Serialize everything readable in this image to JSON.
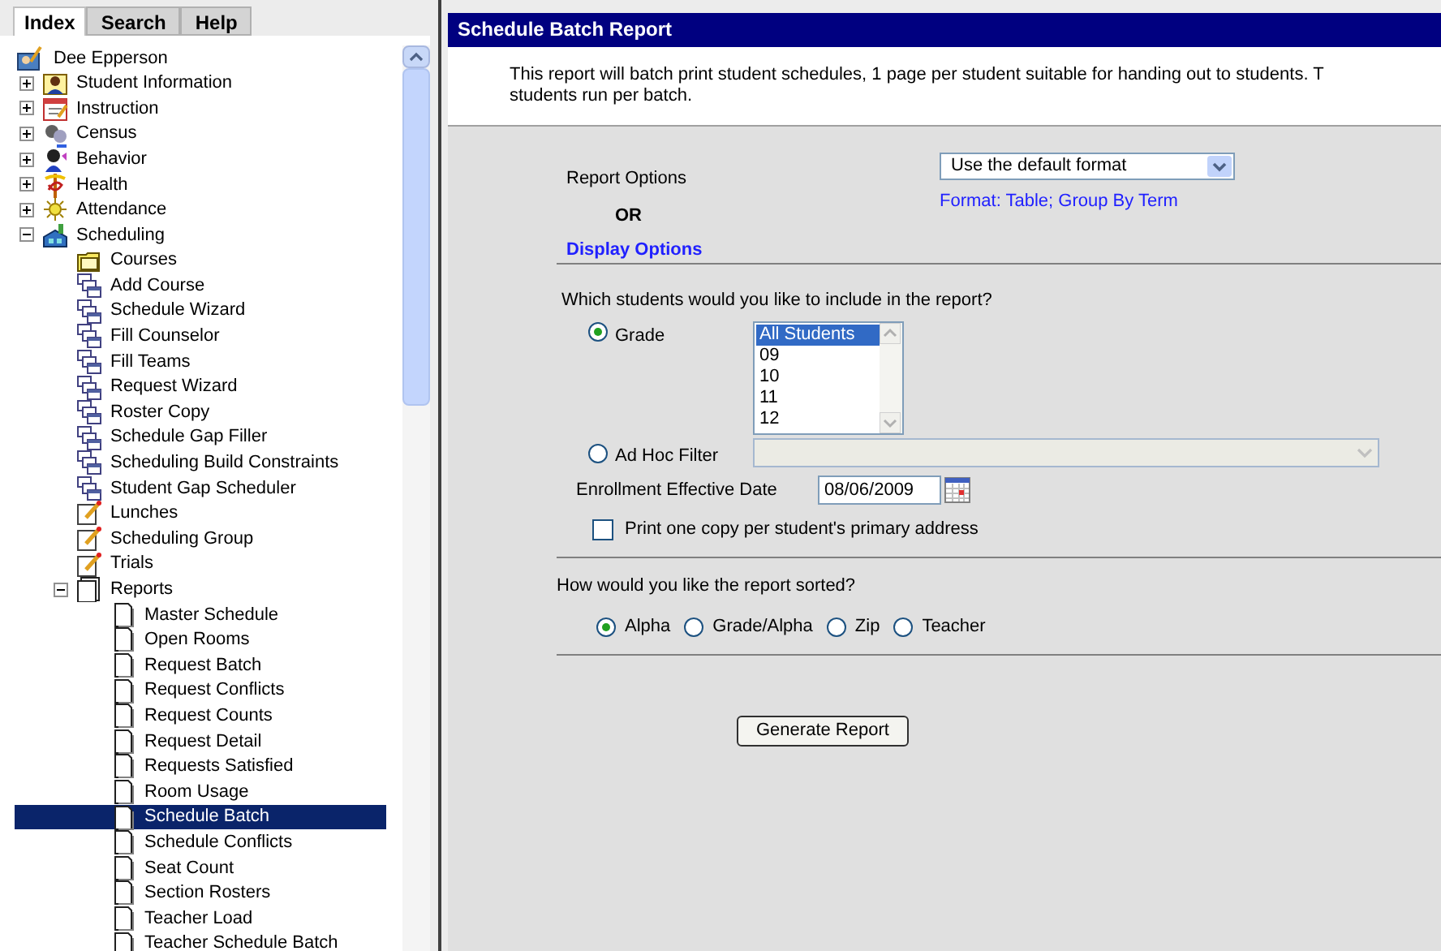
{
  "tabs": [
    {
      "label": "Index",
      "selected": true
    },
    {
      "label": "Search",
      "selected": false
    },
    {
      "label": "Help",
      "selected": false
    }
  ],
  "tree": [
    {
      "label": "Dee Epperson",
      "kind": "user",
      "selected": false,
      "children": [
        {
          "label": "Student Information",
          "kind": "student",
          "selected": false,
          "expanded": false
        },
        {
          "label": "Instruction",
          "kind": "planner",
          "selected": false,
          "expanded": false
        },
        {
          "label": "Census",
          "kind": "census",
          "selected": false,
          "expanded": false
        },
        {
          "label": "Behavior",
          "kind": "behavior",
          "selected": false,
          "expanded": false
        },
        {
          "label": "Health",
          "kind": "health",
          "selected": false,
          "expanded": false
        },
        {
          "label": "Attendance",
          "kind": "sun",
          "selected": false,
          "expanded": false
        },
        {
          "label": "Scheduling",
          "kind": "building",
          "selected": false,
          "expanded": true,
          "children": [
            {
              "label": "Courses",
              "kind": "folder",
              "selected": false
            },
            {
              "label": "Add Course",
              "kind": "windows",
              "selected": false
            },
            {
              "label": "Schedule Wizard",
              "kind": "windows",
              "selected": false
            },
            {
              "label": "Fill Counselor",
              "kind": "windows",
              "selected": false
            },
            {
              "label": "Fill Teams",
              "kind": "windows",
              "selected": false
            },
            {
              "label": "Request Wizard",
              "kind": "windows",
              "selected": false
            },
            {
              "label": "Roster Copy",
              "kind": "windows",
              "selected": false
            },
            {
              "label": "Schedule Gap Filler",
              "kind": "windows",
              "selected": false
            },
            {
              "label": "Scheduling Build Constraints",
              "kind": "windows",
              "selected": false
            },
            {
              "label": "Student Gap Scheduler",
              "kind": "windows",
              "selected": false
            },
            {
              "label": "Lunches",
              "kind": "edit",
              "selected": false
            },
            {
              "label": "Scheduling Group",
              "kind": "edit",
              "selected": false
            },
            {
              "label": "Trials",
              "kind": "edit",
              "selected": false
            },
            {
              "label": "Reports",
              "kind": "pages",
              "selected": false,
              "expanded": true,
              "children": [
                {
                  "label": "Master Schedule",
                  "kind": "page",
                  "selected": false
                },
                {
                  "label": "Open Rooms",
                  "kind": "page",
                  "selected": false
                },
                {
                  "label": "Request Batch",
                  "kind": "page",
                  "selected": false
                },
                {
                  "label": "Request Conflicts",
                  "kind": "page",
                  "selected": false
                },
                {
                  "label": "Request Counts",
                  "kind": "page",
                  "selected": false
                },
                {
                  "label": "Request Detail",
                  "kind": "page",
                  "selected": false
                },
                {
                  "label": "Requests Satisfied",
                  "kind": "page",
                  "selected": false
                },
                {
                  "label": "Room Usage",
                  "kind": "page",
                  "selected": false
                },
                {
                  "label": "Schedule Batch",
                  "kind": "page",
                  "selected": true
                },
                {
                  "label": "Schedule Conflicts",
                  "kind": "page",
                  "selected": false
                },
                {
                  "label": "Seat Count",
                  "kind": "page",
                  "selected": false
                },
                {
                  "label": "Section Rosters",
                  "kind": "page",
                  "selected": false
                },
                {
                  "label": "Teacher Load",
                  "kind": "page",
                  "selected": false
                },
                {
                  "label": "Teacher Schedule Batch",
                  "kind": "page",
                  "selected": false
                }
              ]
            }
          ]
        }
      ]
    }
  ],
  "report": {
    "title": "Schedule Batch Report",
    "description_lines": [
      "This report will batch print student schedules, 1 page per student suitable for handing out to students. T",
      "students run per batch."
    ],
    "report_options": {
      "label": "Report Options",
      "or": "OR",
      "link": "Display Options",
      "select_value": "Use the default format",
      "format_text": "Format: Table; Group By Term"
    },
    "students": {
      "question": "Which students would you like to include in the report?",
      "filters": [
        {
          "kind": "grade",
          "label": "Grade",
          "selected": true,
          "options": [
            {
              "label": "All Students",
              "selected": true
            },
            {
              "label": "09",
              "selected": false
            },
            {
              "label": "10",
              "selected": false
            },
            {
              "label": "11",
              "selected": false
            },
            {
              "label": "12",
              "selected": false
            }
          ]
        },
        {
          "kind": "ad_hoc",
          "label": "Ad Hoc Filter",
          "selected": false,
          "disabled": true
        }
      ]
    },
    "enrollment": {
      "label": "Enrollment Effective Date",
      "value": "08/06/2009"
    },
    "primary_address": {
      "label": "Print one copy per student's primary address",
      "checked": false
    },
    "sort": {
      "question": "How would you like the report sorted?",
      "options": [
        {
          "label": "Alpha",
          "selected": true
        },
        {
          "label": "Grade/Alpha",
          "selected": false
        },
        {
          "label": "Zip",
          "selected": false
        },
        {
          "label": "Teacher",
          "selected": false
        }
      ]
    },
    "button": "Generate Report"
  }
}
